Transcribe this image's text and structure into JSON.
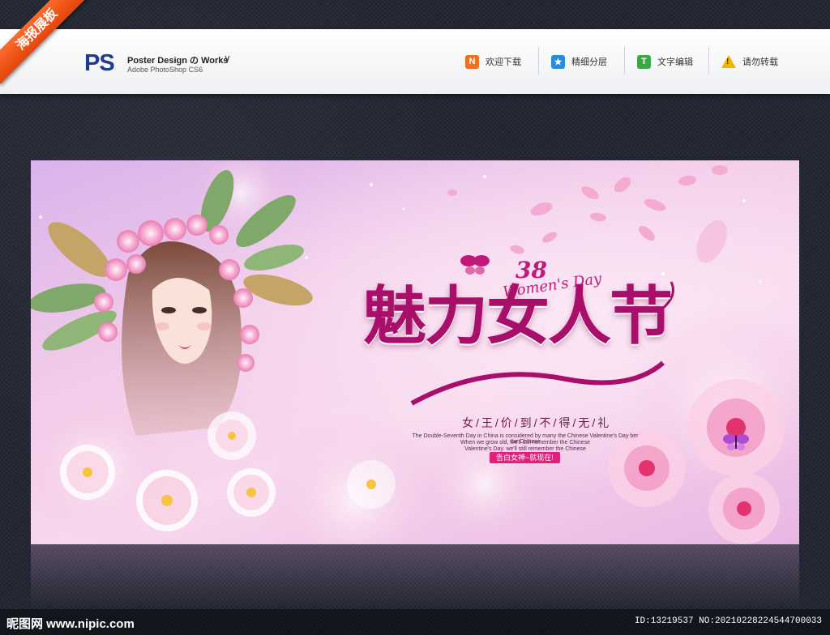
{
  "corner_ribbon": "海报展板",
  "header": {
    "logo": "PS",
    "title": "Poster Design の Works",
    "subtitle": "Adobe PhotoShop CS6",
    "nav": [
      {
        "icon_letter": "N",
        "icon": "n-icon",
        "color": "#f07020",
        "label": "欢迎下载"
      },
      {
        "icon_letter": "★",
        "icon": "star-icon",
        "color": "#2a8ae0",
        "label": "精细分层"
      },
      {
        "icon_letter": "T",
        "icon": "t-icon",
        "color": "#3aa845",
        "label": "文字编辑"
      },
      {
        "icon_letter": "!",
        "icon": "warning-icon",
        "color": "#f2b400",
        "label": "请勿转载"
      }
    ]
  },
  "poster": {
    "number": "38",
    "womens_day": "Women's Day",
    "title": "魅力女人节",
    "slogan": "女/王/价/到/不/得/无/礼",
    "description": [
      "The Double-Seventh Day in China is considered by many the Chinese Valentine's Day ber the Chinese",
      "When we grow old, we'll still remember the Chinese",
      "Valentine's Day. we'll still remember the Chinese",
      "Valentine's Day."
    ],
    "cta": "告白女神~就现在!"
  },
  "footer": {
    "site": "昵图网 www.nipic.com",
    "id_text": "ID:13219537 NO:20210228224544700033"
  },
  "colors": {
    "accent": "#a80f6a",
    "pink": "#e0207c",
    "bg_dark": "#1f2430"
  }
}
